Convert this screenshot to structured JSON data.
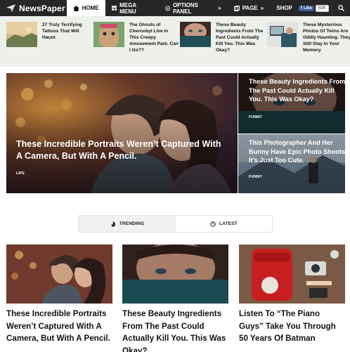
{
  "nav": {
    "logo": "NewsPaper",
    "items": [
      {
        "label": "HOME",
        "icon": "home-icon"
      },
      {
        "label": "MEGA MENU",
        "icon": "menu-icon"
      },
      {
        "label": "OPTIONS PANEL",
        "icon": "gear-icon"
      },
      {
        "label": "PAGE",
        "icon": "page-icon"
      },
      {
        "label": "SHOP"
      }
    ],
    "fb_like": "Like",
    "fb_count": "43K"
  },
  "strip": [
    {
      "title": "27 Truly Terrifying Tattoos That Will Haunt"
    },
    {
      "title": "The Ghosts of Chernobyl Live In This Creepy Amusement Park. Can I Go??"
    },
    {
      "title": "These Beauty Ingredients From The Past Could Actually Kill You. This Was Okay?"
    },
    {
      "title": "These Mysterious Photos Of Twins Are Oddly Haunting. They Still Stay In Your Memory."
    }
  ],
  "hero": {
    "main": {
      "title": "These Incredible Portraits Weren’t Captured With A Camera, But With A Pencil.",
      "category": "LIFE"
    },
    "side1": {
      "title": "These Beauty Ingredients From The Past Could Actually Kill You. This Was Okay?",
      "category": "FUNNY"
    },
    "side2": {
      "title": "This Photographer And Her Bunny Have Epic Photo Shoots. It’s Just Too Cute.",
      "category": "FUNNY"
    }
  },
  "tabs": {
    "trending": "TRENDING",
    "latest": "LATEST"
  },
  "cards": [
    {
      "title": "These Incredible Portraits Weren’t Captured With A Camera, But With A Pencil."
    },
    {
      "title": "These Beauty Ingredients From The Past Could Actually Kill You. This Was Okay?"
    },
    {
      "title": "Listen To “The Piano Guys” Take You Through 50 Years Of Batman"
    }
  ]
}
